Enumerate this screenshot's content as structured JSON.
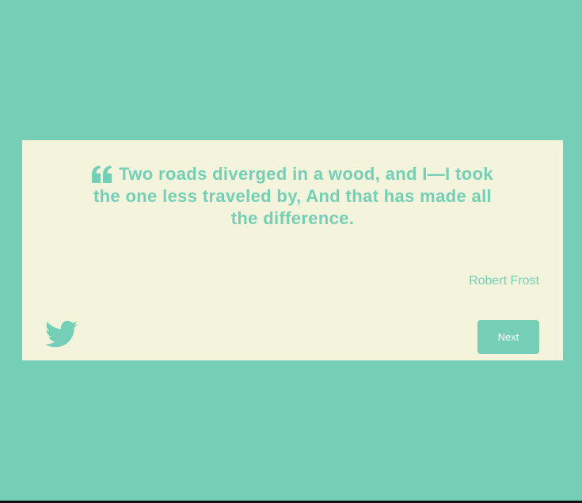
{
  "quote": {
    "icon": "quote-left-icon",
    "text": "Two roads diverged in a wood, and I—I took the one less traveled by, And that has made all the difference.",
    "author": "Robert Frost"
  },
  "actions": {
    "tweet_icon": "twitter-icon",
    "next_label": "Next"
  },
  "colors": {
    "background": "#75cfb7",
    "card": "#f4f4dd",
    "accent": "#75cfb7",
    "button_text": "#ffffff"
  }
}
